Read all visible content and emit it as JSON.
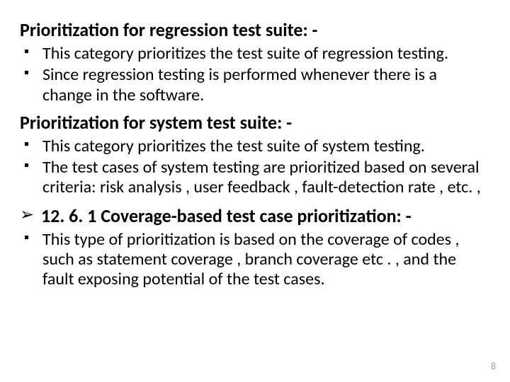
{
  "sections": [
    {
      "type": "heading",
      "text": "Prioritization for regression test suite: -"
    },
    {
      "type": "bullets",
      "items": [
        "This category prioritizes the test suite of regression testing.",
        " Since regression testing is performed whenever there is a change in the software."
      ]
    },
    {
      "type": "heading",
      "text": "Prioritization for system test suite: -"
    },
    {
      "type": "bullets",
      "items": [
        "This category prioritizes the test suite of system testing.",
        "The test cases of system testing are prioritized based on several criteria: risk analysis  , user feedback , fault-detection rate , etc. ,"
      ]
    },
    {
      "type": "arrow",
      "text": "12. 6. 1 Coverage-based test case prioritization: -"
    },
    {
      "type": "bullets",
      "items": [
        " This type of prioritization is based on the coverage of codes , such as statement coverage , branch coverage etc . , and the fault exposing potential of the test cases."
      ]
    }
  ],
  "pageNumber": "8"
}
